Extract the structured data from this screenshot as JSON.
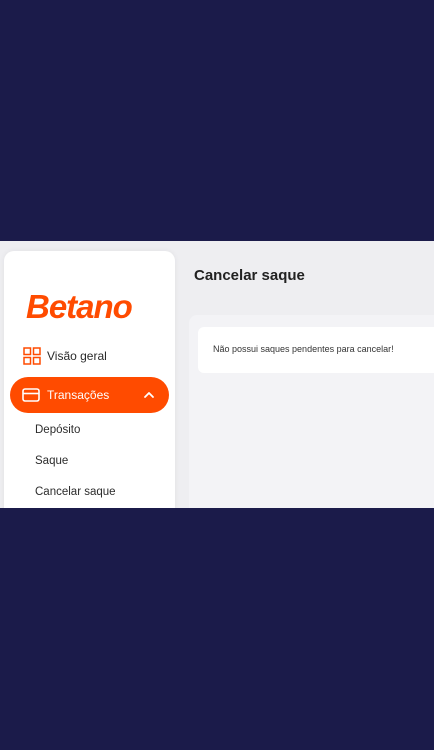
{
  "brand": {
    "logo_text": "Betano",
    "accent_color": "#ff4b00"
  },
  "sidebar": {
    "items": [
      {
        "label": "Visão geral",
        "icon": "grid-icon"
      },
      {
        "label": "Transações",
        "icon": "card-icon",
        "expanded": true,
        "active": true
      }
    ],
    "submenu": [
      {
        "label": "Depósito"
      },
      {
        "label": "Saque"
      },
      {
        "label": "Cancelar saque"
      }
    ]
  },
  "main": {
    "title": "Cancelar saque",
    "message": "Não possui saques pendentes para cancelar!"
  },
  "colors": {
    "backdrop": "#1b1b4a",
    "surface": "#eeeef1",
    "card": "#ffffff"
  }
}
